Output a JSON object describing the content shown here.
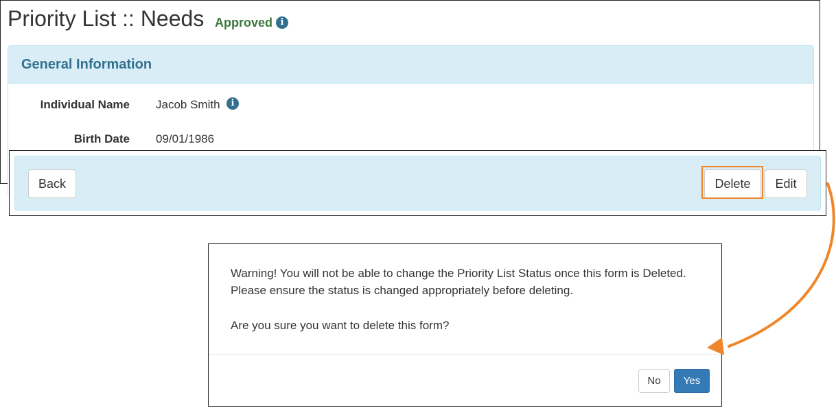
{
  "header": {
    "title": "Priority List :: Needs",
    "status": "Approved",
    "status_color": "#3c763d",
    "status_info_icon": "info-circle-icon"
  },
  "panel": {
    "heading": "General Information",
    "fields": [
      {
        "label": "Individual Name",
        "value": "Jacob Smith",
        "info_icon": "info-circle-icon"
      },
      {
        "label": "Birth Date",
        "value": "09/01/1986"
      }
    ]
  },
  "footer": {
    "back_label": "Back",
    "delete_label": "Delete",
    "edit_label": "Edit",
    "highlight_color": "#f0862a"
  },
  "modal": {
    "warning_line1": "Warning! You will not be able to change the Priority List Status once this form is Deleted.",
    "warning_line2": "Please ensure the status is changed appropriately before deleting.",
    "question": "Are you sure you want to delete this form?",
    "no_label": "No",
    "yes_label": "Yes",
    "yes_color": "#337ab7"
  },
  "annotation": {
    "arrow_color": "#f0862a",
    "arrow_meaning": "Delete button opens confirmation dialog"
  }
}
